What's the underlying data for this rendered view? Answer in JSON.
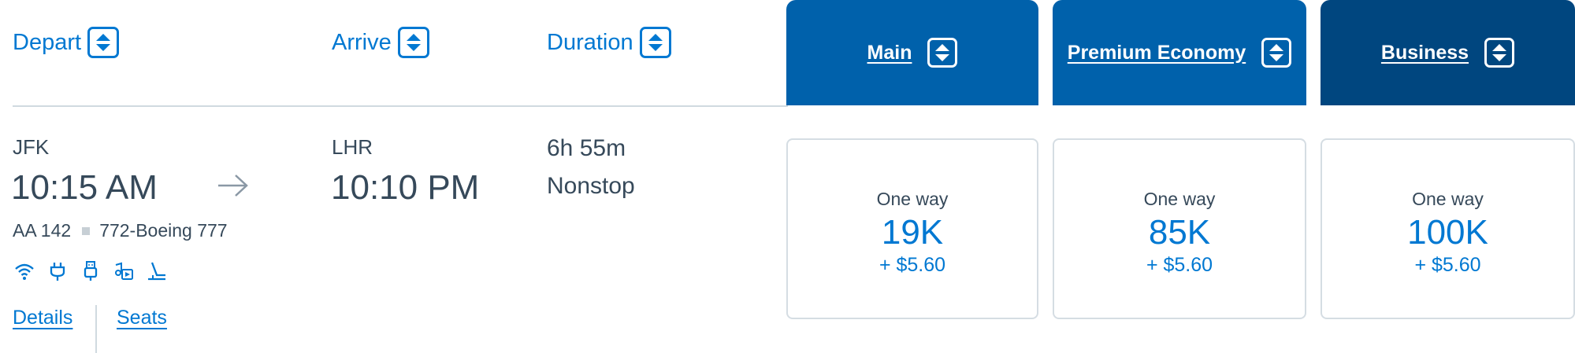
{
  "header": {
    "depart_label": "Depart",
    "arrive_label": "Arrive",
    "duration_label": "Duration"
  },
  "cabins": [
    {
      "label": "Main",
      "color": "#0061ab"
    },
    {
      "label": "Premium Economy",
      "color": "#0061ab"
    },
    {
      "label": "Business",
      "color": "#00467f"
    }
  ],
  "flight": {
    "origin": "JFK",
    "depart_time": "10:15 AM",
    "destination": "LHR",
    "arrive_time": "10:10 PM",
    "duration": "6h 55m",
    "stops": "Nonstop",
    "flight_number": "AA 142",
    "aircraft": "772-Boeing 777",
    "amenities": [
      "wifi-icon",
      "power-outlet-icon",
      "usb-icon",
      "entertainment-icon",
      "lie-flat-seat-icon"
    ],
    "details_link": "Details",
    "seats_link": "Seats"
  },
  "fares": [
    {
      "label": "One way",
      "price": "19K",
      "fee": "+ $5.60"
    },
    {
      "label": "One way",
      "price": "85K",
      "fee": "+ $5.60"
    },
    {
      "label": "One way",
      "price": "100K",
      "fee": "+ $5.60"
    }
  ],
  "colors": {
    "accent": "#0078d2",
    "tab_blue": "#0061ab",
    "tab_dark": "#00467f",
    "text": "#36495a"
  }
}
